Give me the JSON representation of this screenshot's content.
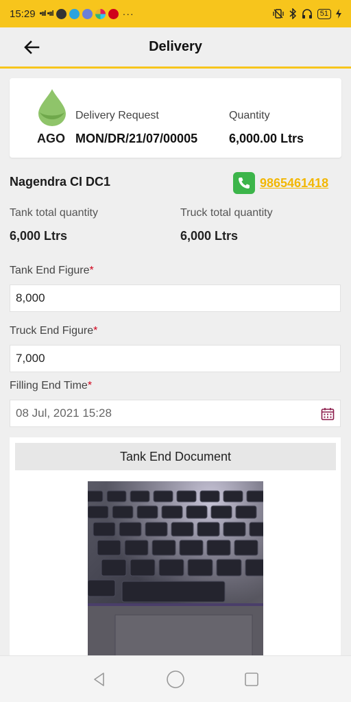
{
  "status_bar": {
    "time": "15:29",
    "signal": "•ııl •ııl",
    "more": "···",
    "battery": "51"
  },
  "header": {
    "title": "Delivery"
  },
  "summary": {
    "product": "AGO",
    "request_label": "Delivery Request",
    "request_value": "MON/DR/21/07/00005",
    "quantity_label": "Quantity",
    "quantity_value": "6,000.00 Ltrs"
  },
  "customer": {
    "name": "Nagendra CI DC1",
    "phone": "9865461418"
  },
  "quantities": {
    "tank_label": "Tank total quantity",
    "tank_value": "6,000 Ltrs",
    "truck_label": "Truck total quantity",
    "truck_value": "6,000 Ltrs"
  },
  "form": {
    "tank_end_label": "Tank End Figure",
    "tank_end_value": "8,000",
    "truck_end_label": "Truck End Figure",
    "truck_end_value": "7,000",
    "filling_end_label": "Filling End Time",
    "filling_end_value": "08 Jul, 2021 15:28",
    "required_mark": "*"
  },
  "document": {
    "title": "Tank End Document"
  },
  "colors": {
    "accent": "#f7c51c",
    "link": "#f2b705",
    "phone_green": "#3cb54a",
    "required": "#d0021b"
  },
  "icons": [
    "back-arrow-icon",
    "water-drop-icon",
    "phone-icon",
    "calendar-icon",
    "nav-back-icon",
    "nav-home-icon",
    "nav-recents-icon"
  ]
}
